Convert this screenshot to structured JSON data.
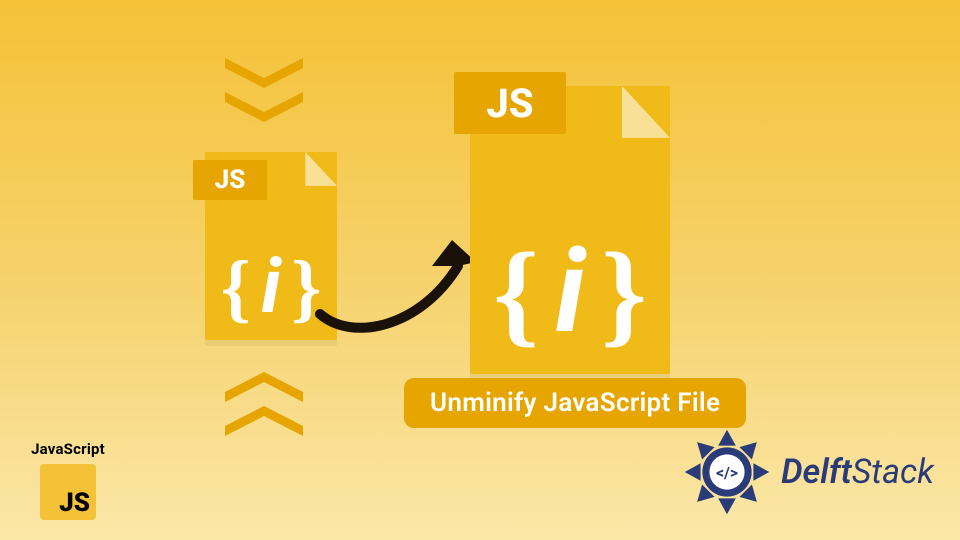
{
  "illustration": {
    "small_file_tag": "JS",
    "small_file_brace_open": "{",
    "small_file_symbol": "i",
    "small_file_brace_close": "}",
    "large_file_tag": "JS",
    "large_file_brace_open": "{",
    "large_file_symbol": "i",
    "large_file_brace_close": "}",
    "caption": "Unminify JavaScript File"
  },
  "mascot": {
    "label": "JavaScript",
    "badge": "JS"
  },
  "brand": {
    "name_strong": "Delft",
    "name_light": "Stack",
    "seal_glyph": "</>"
  },
  "colors": {
    "accent": "#e6a500",
    "file": "#f0ba18",
    "brand": "#2a3b7a",
    "arrow": "#1a1208"
  }
}
